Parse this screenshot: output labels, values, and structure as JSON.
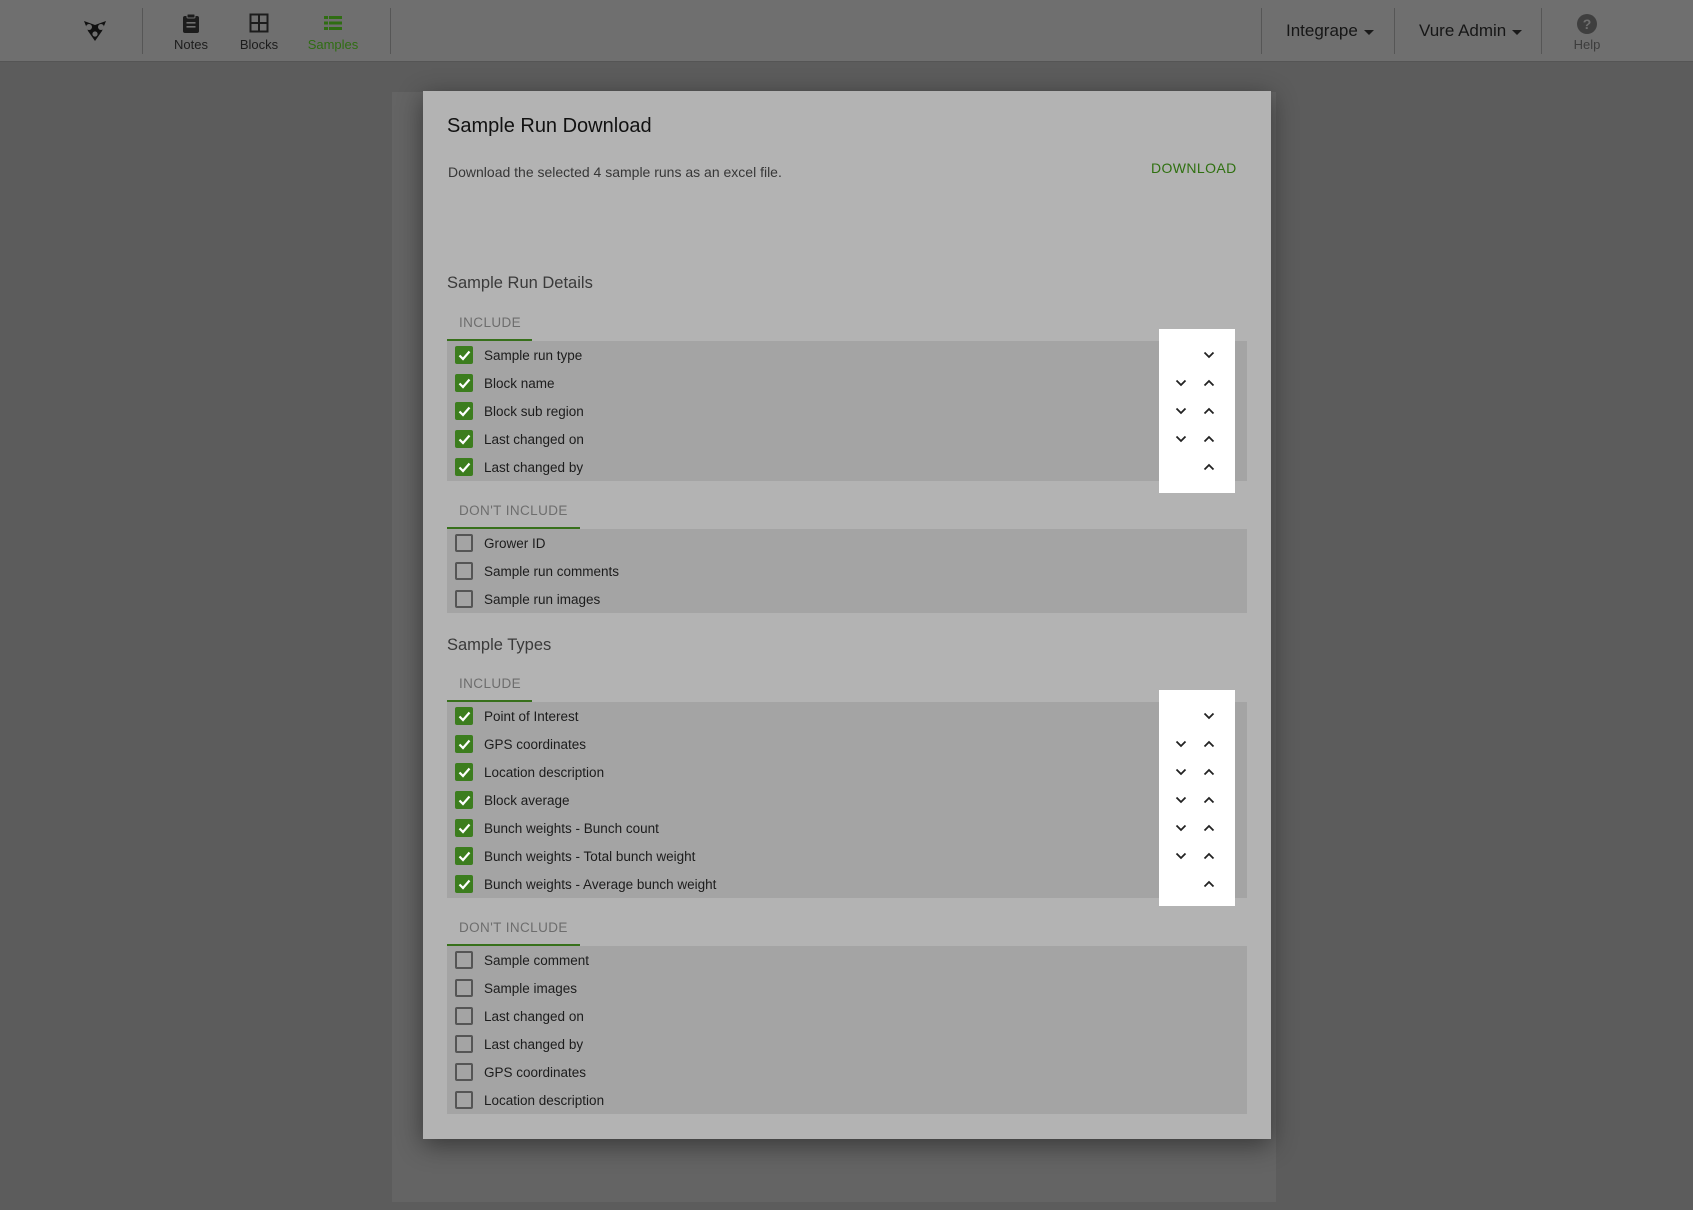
{
  "nav": {
    "items": [
      {
        "label": "Notes",
        "icon": "clipboard-icon"
      },
      {
        "label": "Blocks",
        "icon": "grid-icon"
      },
      {
        "label": "Samples",
        "icon": "list-icon",
        "active": true
      }
    ],
    "org_menu": "Integrape",
    "user_menu": "Vure Admin",
    "help_label": "Help",
    "help_glyph": "?"
  },
  "dialog": {
    "title": "Sample Run Download",
    "description": "Download the selected 4 sample runs as an excel file.",
    "download_label": "DOWNLOAD",
    "sections": [
      {
        "title": "Sample Run Details",
        "include_label": "INCLUDE",
        "exclude_label": "DON'T INCLUDE",
        "included": [
          "Sample run type",
          "Block name",
          "Block sub region",
          "Last changed on",
          "Last changed by"
        ],
        "excluded": [
          "Grower ID",
          "Sample run comments",
          "Sample run images"
        ]
      },
      {
        "title": "Sample Types",
        "include_label": "INCLUDE",
        "exclude_label": "DON'T INCLUDE",
        "included": [
          "Point of Interest",
          "GPS coordinates",
          "Location description",
          "Block average",
          "Bunch weights - Bunch count",
          "Bunch weights - Total bunch weight",
          "Bunch weights - Average bunch weight"
        ],
        "excluded": [
          "Sample comment",
          "Sample images",
          "Last changed on",
          "Last changed by",
          "GPS coordinates",
          "Location description"
        ]
      }
    ]
  },
  "colors": {
    "accent": "#3c7d1e",
    "active_nav": "#2f6d12"
  }
}
